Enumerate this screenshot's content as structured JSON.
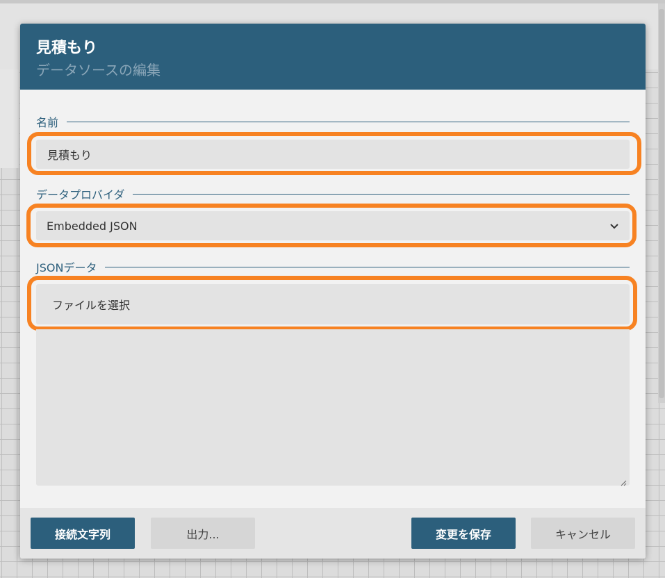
{
  "dialog": {
    "title": "見積もり",
    "subtitle": "データソースの編集"
  },
  "name_section": {
    "label": "名前",
    "value": "見積もり"
  },
  "provider_section": {
    "label": "データプロバイダ",
    "selected": "Embedded JSON"
  },
  "json_section": {
    "label": "JSONデータ",
    "file_button": "ファイルを選択",
    "content": ""
  },
  "footer": {
    "connection_string_label": "接続文字列",
    "export_label": "出力...",
    "save_label": "変更を保存",
    "cancel_label": "キャンセル"
  },
  "icons": {
    "dropdown": "chevron-down-icon",
    "resize": "resize-grip-icon"
  },
  "colors": {
    "primary": "#2c5f7c",
    "highlight": "#f78222",
    "field_bg": "#e3e3e3"
  }
}
